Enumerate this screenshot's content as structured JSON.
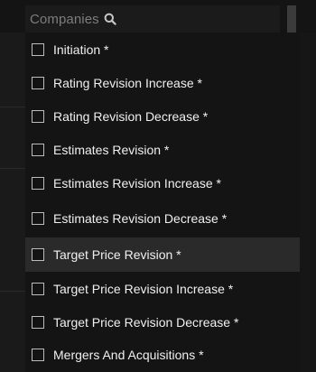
{
  "search": {
    "text": "Companies",
    "icon": "search-icon"
  },
  "filter_list": {
    "items": [
      {
        "label": "Initiation *",
        "checked": false
      },
      {
        "label": "Rating Revision Increase *",
        "checked": false
      },
      {
        "label": "Rating Revision Decrease *",
        "checked": false
      },
      {
        "label": "Estimates Revision *",
        "checked": false
      },
      {
        "label": "Estimates Revision Increase *",
        "checked": false
      },
      {
        "label": "Estimates Revision Decrease *",
        "checked": false
      },
      {
        "label": "Target Price Revision *",
        "checked": false,
        "highlighted": true
      },
      {
        "label": "Target Price Revision Increase *",
        "checked": false
      },
      {
        "label": "Target Price Revision Decrease *",
        "checked": false
      },
      {
        "label": "Mergers And Acquisitions *",
        "checked": false
      }
    ]
  },
  "colors": {
    "background": "#161616",
    "highlight": "#2a2a2a",
    "text": "#f0f0f0",
    "placeholder": "#7d7d7d"
  }
}
